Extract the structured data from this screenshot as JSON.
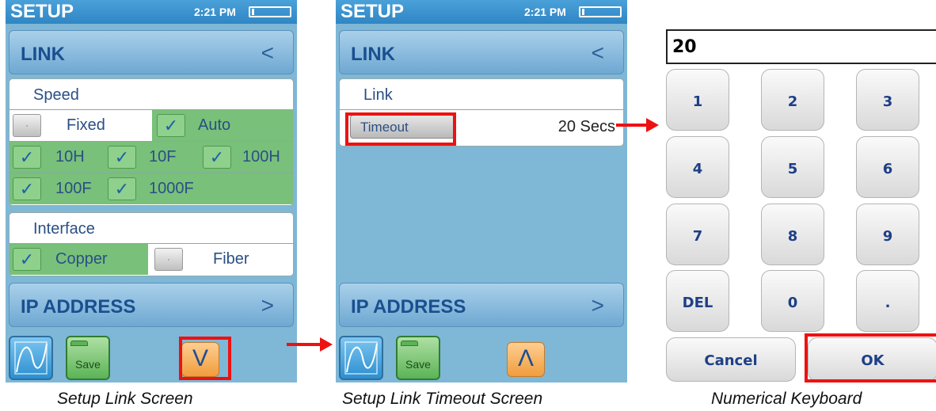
{
  "screen1": {
    "status": {
      "title": "SETUP",
      "time": "2:21 PM"
    },
    "link_header": {
      "label": "LINK",
      "chevron": "<"
    },
    "speed": {
      "title": "Speed",
      "fixed": "Fixed",
      "auto": "Auto",
      "options": [
        "10H",
        "10F",
        "100H",
        "100F",
        "1000F"
      ]
    },
    "interface": {
      "title": "Interface",
      "copper": "Copper",
      "fiber": "Fiber"
    },
    "ip_header": {
      "label": "IP ADDRESS",
      "chevron": ">"
    },
    "toolbar": {
      "save_label": "Save",
      "nav_symbol": "V"
    },
    "caption": "Setup Link Screen"
  },
  "screen2": {
    "status": {
      "title": "SETUP",
      "time": "2:21 PM"
    },
    "link_header": {
      "label": "LINK",
      "chevron": "<"
    },
    "link_panel": {
      "title": "Link",
      "timeout_label": "Timeout",
      "timeout_value": "20 Secs"
    },
    "ip_header": {
      "label": "IP ADDRESS",
      "chevron": ">"
    },
    "toolbar": {
      "save_label": "Save",
      "nav_symbol": "Λ"
    },
    "caption": "Setup Link Timeout Screen"
  },
  "keyboard": {
    "display_value": "20",
    "keys": [
      "1",
      "2",
      "3",
      "4",
      "5",
      "6",
      "7",
      "8",
      "9",
      "DEL",
      "0",
      "."
    ],
    "cancel": "Cancel",
    "ok": "OK",
    "caption": "Numerical Keyboard"
  },
  "colors": {
    "highlight": "#ee1111",
    "selected_green": "#79c07a",
    "screen_bg": "#7fb7d6",
    "key_text": "#1e3f86"
  },
  "icons": {
    "graph": "graph-icon",
    "save": "save-folder-icon",
    "checkmark": "checkmark-icon"
  }
}
